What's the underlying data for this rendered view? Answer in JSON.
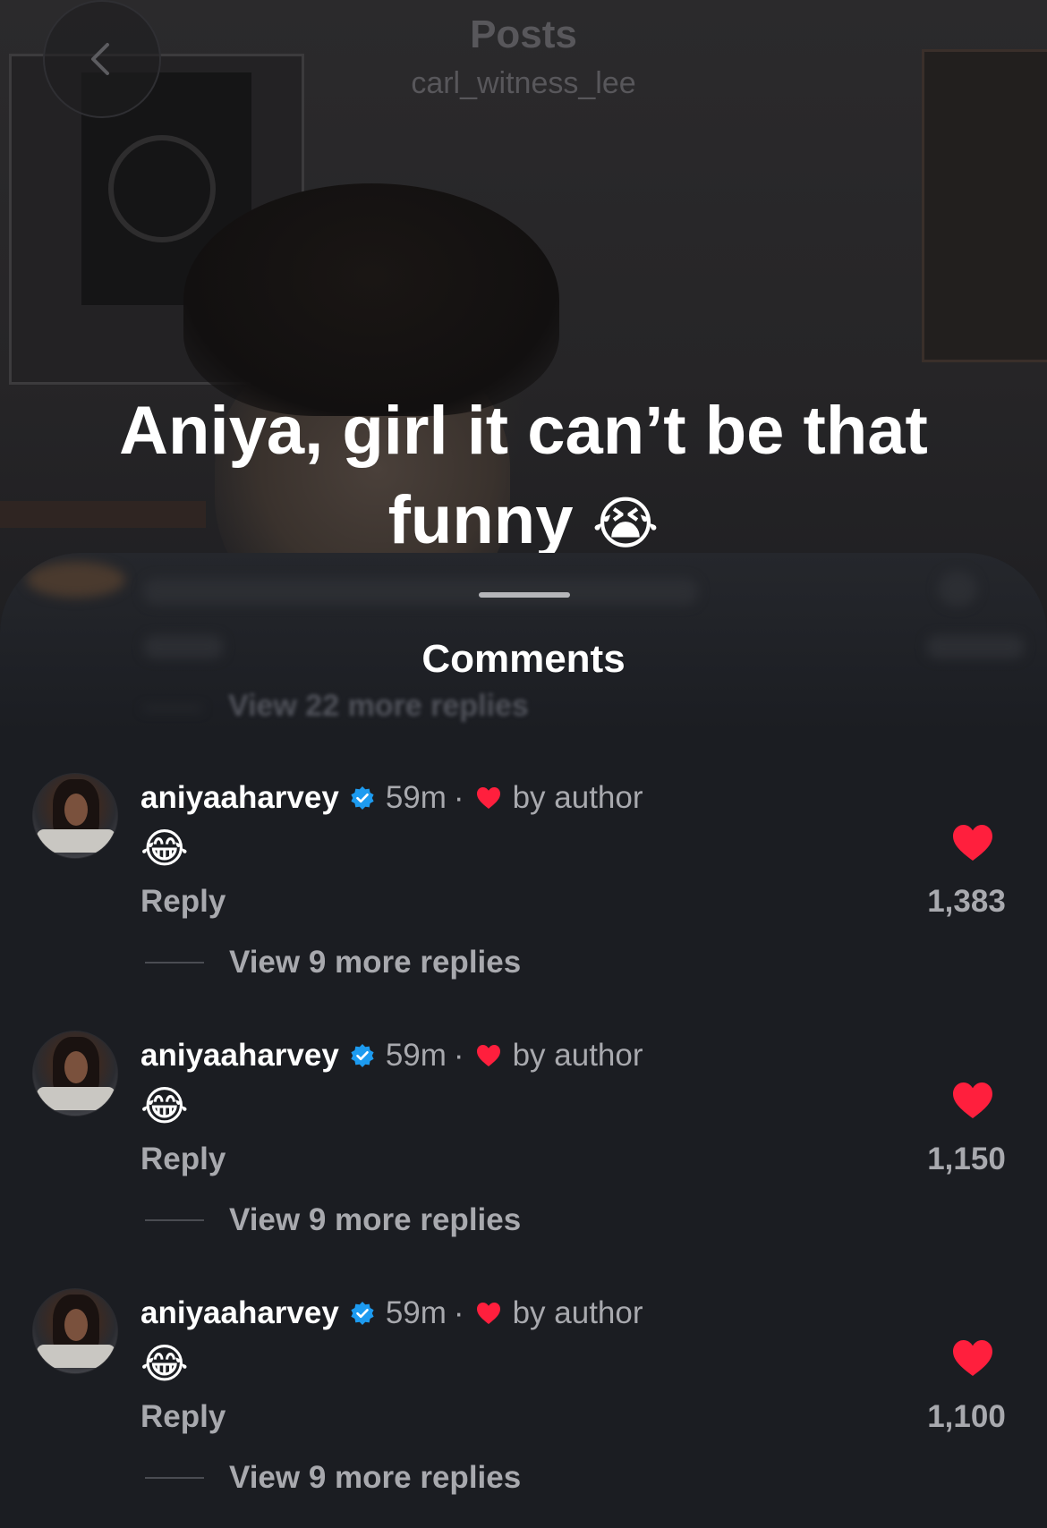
{
  "header": {
    "title": "Posts",
    "subtitle": "carl_witness_lee"
  },
  "post": {
    "caption_line1": "Aniya, girl it can’t be that",
    "caption_line2": "funny",
    "caption_emoji": "😭"
  },
  "sheet": {
    "title": "Comments",
    "hidden_replies_label": "View 22 more replies"
  },
  "colors": {
    "background": "#1b1d22",
    "text_secondary": "#a8a9ae",
    "like_red": "#ff1f3d",
    "verified_blue": "#1d9bf0"
  },
  "comments": [
    {
      "username": "aniyaaharvey",
      "verified": true,
      "time": "59m",
      "separator": "·",
      "liked_by_author": "by author",
      "text": "😂",
      "reply_label": "Reply",
      "likes": "1,383",
      "view_replies": "View 9 more replies"
    },
    {
      "username": "aniyaaharvey",
      "verified": true,
      "time": "59m",
      "separator": "·",
      "liked_by_author": "by author",
      "text": "😂",
      "reply_label": "Reply",
      "likes": "1,150",
      "view_replies": "View 9 more replies"
    },
    {
      "username": "aniyaaharvey",
      "verified": true,
      "time": "59m",
      "separator": "·",
      "liked_by_author": "by author",
      "text": "😂",
      "reply_label": "Reply",
      "likes": "1,100",
      "view_replies": "View 9 more replies"
    }
  ]
}
